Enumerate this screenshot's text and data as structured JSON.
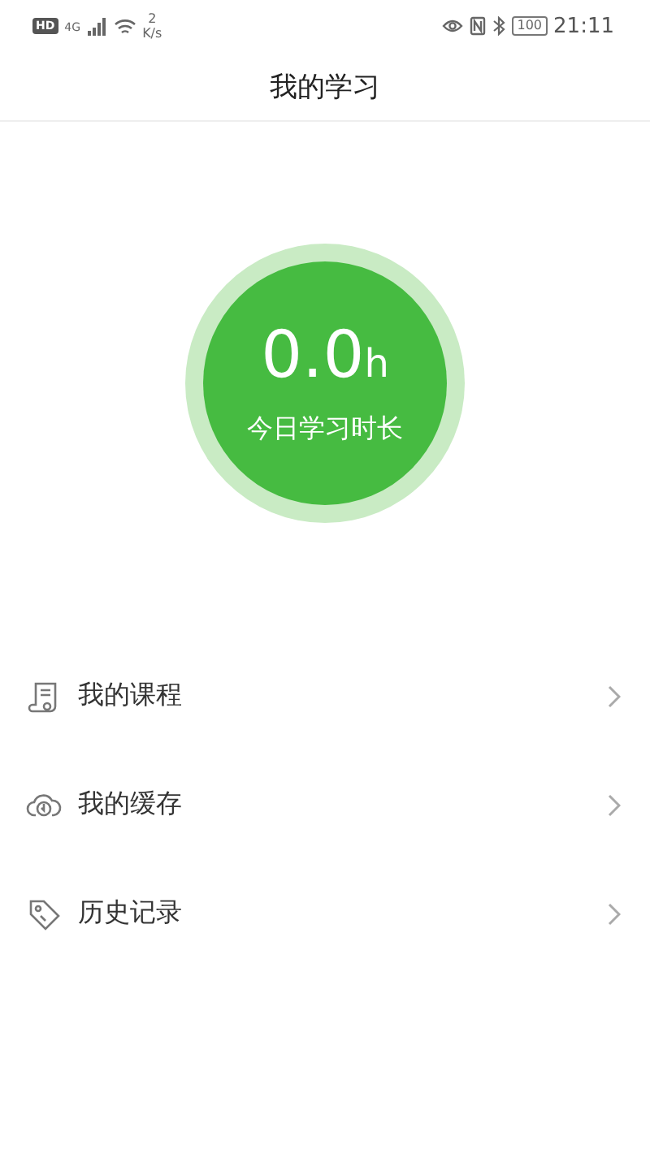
{
  "status_bar": {
    "hd": "HD",
    "network": "4G",
    "speed_value": "2",
    "speed_unit": "K/s",
    "battery": "100",
    "time": "21:11"
  },
  "header": {
    "title": "我的学习"
  },
  "today": {
    "value": "0.0",
    "unit": "h",
    "label": "今日学习时长"
  },
  "menu": [
    {
      "kind": "courses",
      "label": "我的课程"
    },
    {
      "kind": "cache",
      "label": "我的缓存"
    },
    {
      "kind": "history",
      "label": "历史记录"
    }
  ]
}
